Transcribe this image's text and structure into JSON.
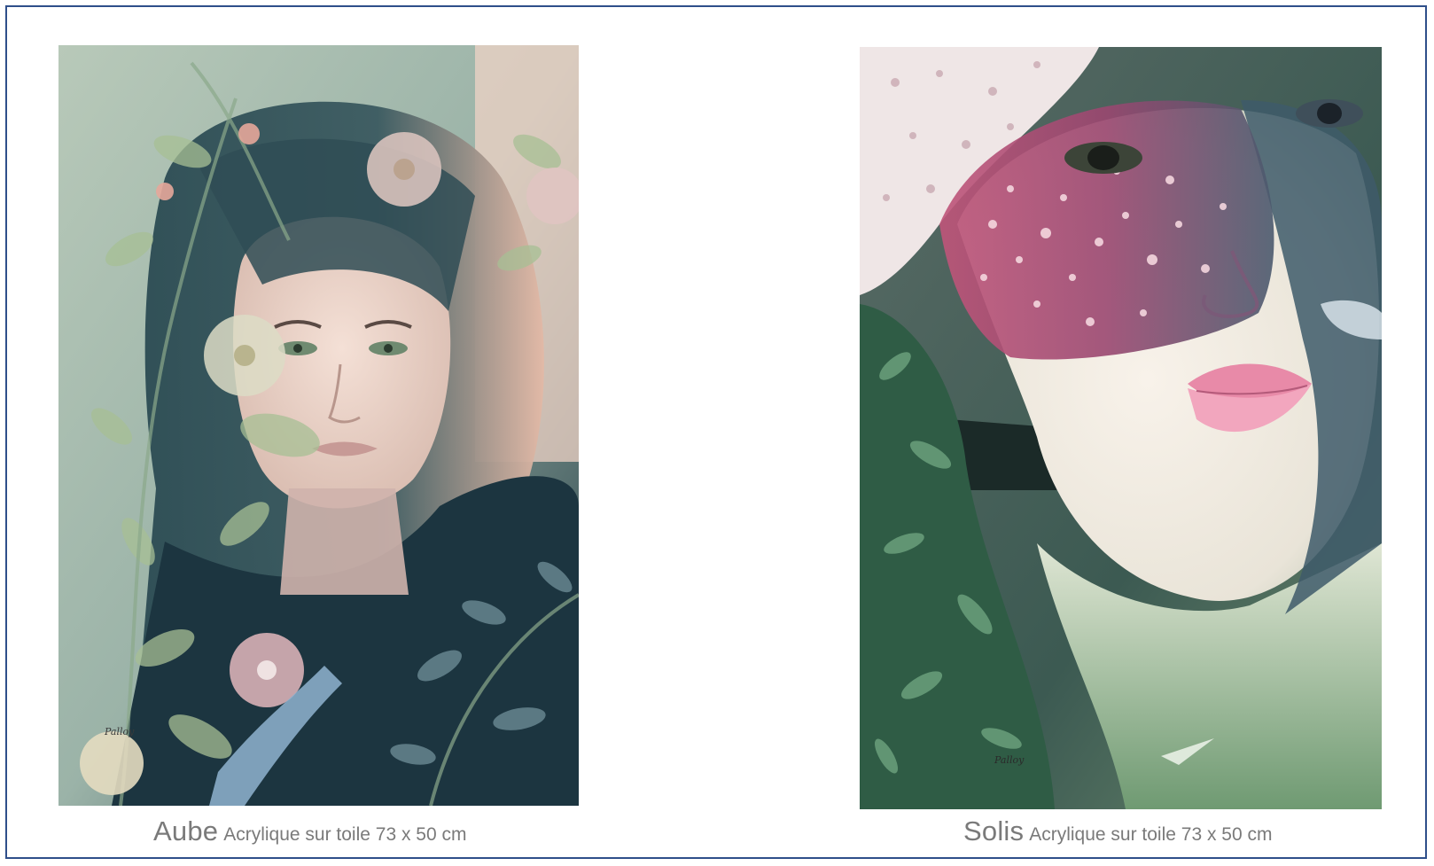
{
  "artworks": [
    {
      "title": "Aube",
      "medium": "Acrylique sur toile 73 x 50 cm",
      "signature": "Palloy",
      "colors": {
        "background": "#9bb3a8",
        "hair_dark": "#1e3b44",
        "hair_light": "#e8c3b3",
        "skin": "#f0d6cc",
        "leaves": "#a7bf95",
        "flowers_pink": "#d8b0b6",
        "flowers_cream": "#e4e4cc"
      }
    },
    {
      "title": "Solis",
      "medium": "Acrylique sur toile 73 x 50 cm",
      "signature": "Palloy",
      "colors": {
        "background": "#3c5a52",
        "shadow_magenta": "#a8486e",
        "skin": "#f3ebe0",
        "lips": "#e88aa8",
        "hat": "#efe6e6",
        "foliage": "#3f7a58"
      }
    }
  ],
  "frame": {
    "border_color": "#2f4f8a"
  }
}
